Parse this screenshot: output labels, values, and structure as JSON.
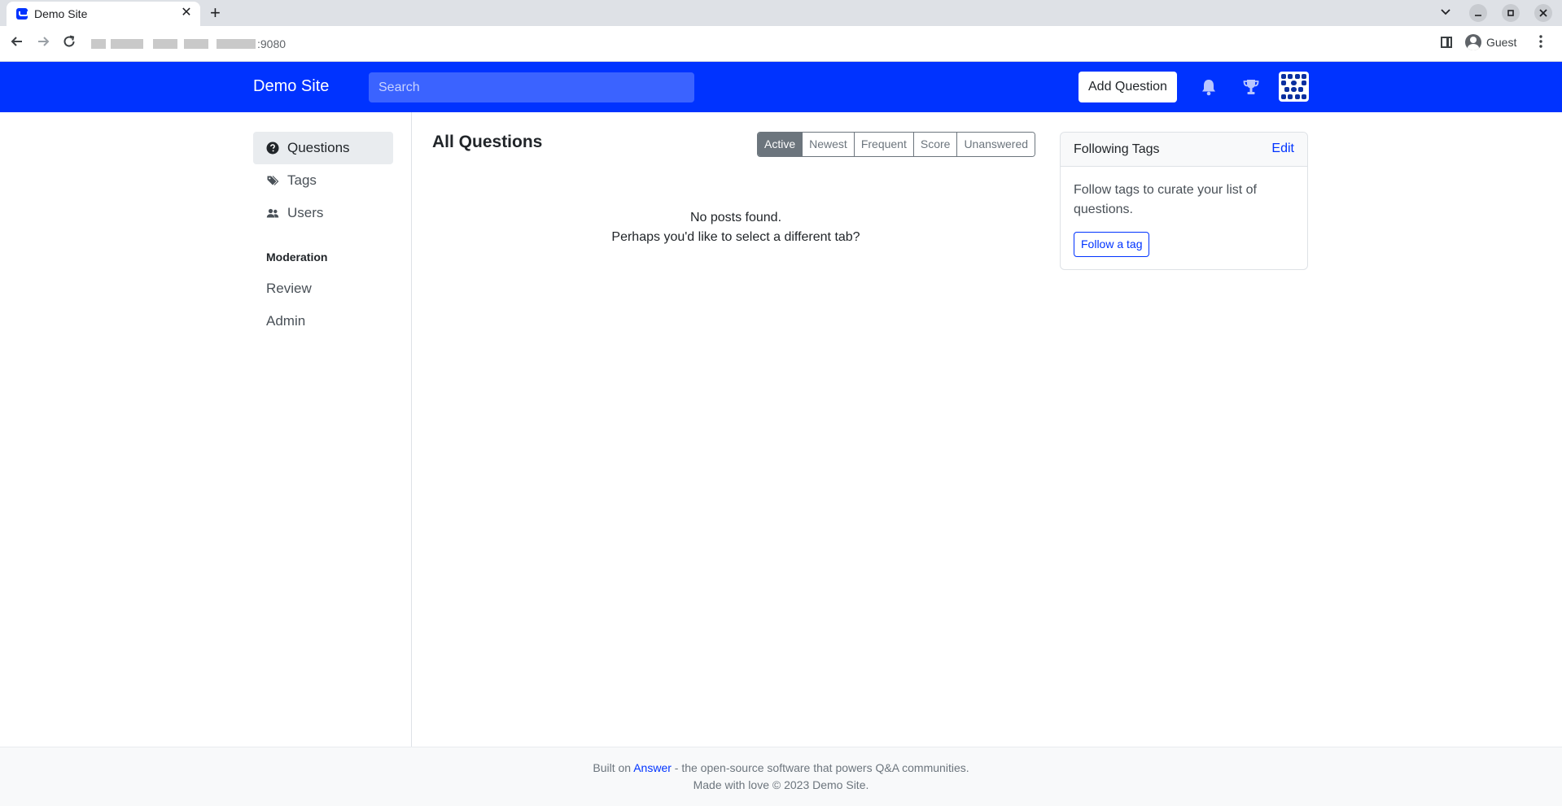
{
  "browser": {
    "tab_title": "Demo Site",
    "tab_close": "✕",
    "new_tab": "+",
    "url_port": ":9080",
    "profile_name": "Guest"
  },
  "header": {
    "brand": "Demo Site",
    "search_placeholder": "Search",
    "add_question_label": "Add Question"
  },
  "sidebar": {
    "items": [
      {
        "label": "Questions",
        "icon": "question-circle-icon",
        "active": true
      },
      {
        "label": "Tags",
        "icon": "tags-icon",
        "active": false
      },
      {
        "label": "Users",
        "icon": "users-icon",
        "active": false
      }
    ],
    "moderation_heading": "Moderation",
    "moderation_links": [
      "Review",
      "Admin"
    ]
  },
  "main": {
    "title": "All Questions",
    "sort_tabs": [
      {
        "label": "Active",
        "active": true
      },
      {
        "label": "Newest",
        "active": false
      },
      {
        "label": "Frequent",
        "active": false
      },
      {
        "label": "Score",
        "active": false
      },
      {
        "label": "Unanswered",
        "active": false
      }
    ],
    "empty_line_1": "No posts found.",
    "empty_line_2": "Perhaps you'd like to select a different tab?"
  },
  "following_tags": {
    "title": "Following Tags",
    "edit_label": "Edit",
    "description": "Follow tags to curate your list of questions.",
    "follow_button": "Follow a tag"
  },
  "footer": {
    "built_on_prefix": "Built on",
    "answer_link": "Answer",
    "built_on_suffix": "- the open-source software that powers Q&A communities.",
    "made_with": "Made with love © 2023 Demo Site."
  },
  "colors": {
    "brand_blue": "#0033ff",
    "header_search_bg": "#3b63ff",
    "active_tab_gray": "#6c757d"
  }
}
